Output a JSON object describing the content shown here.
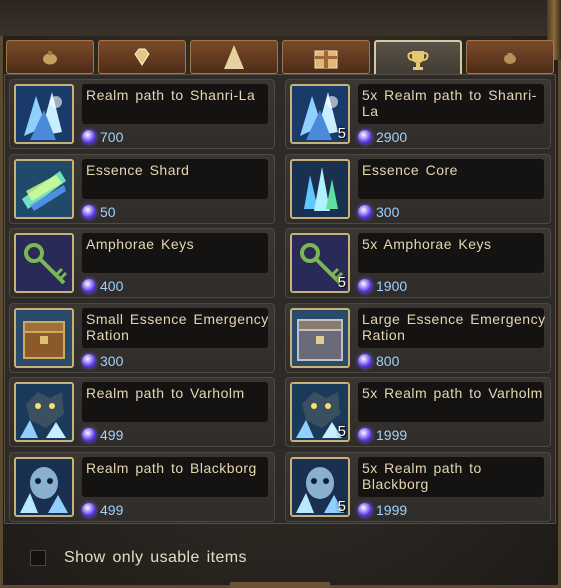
{
  "tabs": [
    {
      "icon": "pouch-icon",
      "active": false
    },
    {
      "icon": "diamond-icon",
      "active": false
    },
    {
      "icon": "pyramid-icon",
      "active": false
    },
    {
      "icon": "gift-box-icon",
      "active": false
    },
    {
      "icon": "trophy-icon",
      "active": true
    },
    {
      "icon": "money-bag-icon",
      "active": false
    }
  ],
  "items": [
    {
      "name": "Realm path to Shanri-La",
      "price": "700",
      "qty": "",
      "icon": "ice-crystal-icon"
    },
    {
      "name": "5x Realm path to Shanri-La",
      "price": "2900",
      "qty": "5",
      "icon": "ice-crystal-icon"
    },
    {
      "name": "Essence Shard",
      "price": "50",
      "qty": "",
      "icon": "essence-shard-icon"
    },
    {
      "name": "Essence Core",
      "price": "300",
      "qty": "",
      "icon": "essence-core-icon"
    },
    {
      "name": "Amphorae Keys",
      "price": "400",
      "qty": "",
      "icon": "key-icon"
    },
    {
      "name": "5x Amphorae Keys",
      "price": "1900",
      "qty": "5",
      "icon": "key-icon"
    },
    {
      "name": "Small Essence Emergency Ration",
      "price": "300",
      "qty": "",
      "icon": "chest-icon"
    },
    {
      "name": "Large Essence Emergency Ration",
      "price": "800",
      "qty": "",
      "icon": "large-chest-icon"
    },
    {
      "name": "Realm path to Varholm",
      "price": "499",
      "qty": "",
      "icon": "wolf-crystal-icon"
    },
    {
      "name": "5x Realm path to Varholm",
      "price": "1999",
      "qty": "5",
      "icon": "wolf-crystal-icon"
    },
    {
      "name": "Realm path to Blackborg",
      "price": "499",
      "qty": "",
      "icon": "ghost-crystal-icon"
    },
    {
      "name": "5x Realm path to Blackborg",
      "price": "1999",
      "qty": "5",
      "icon": "ghost-crystal-icon"
    }
  ],
  "filter": {
    "label": "Show only usable items",
    "checked": false
  },
  "colors": {
    "currency": "#5a38e0",
    "price_text": "#9fd2ff",
    "item_border": "#c9b27a"
  }
}
